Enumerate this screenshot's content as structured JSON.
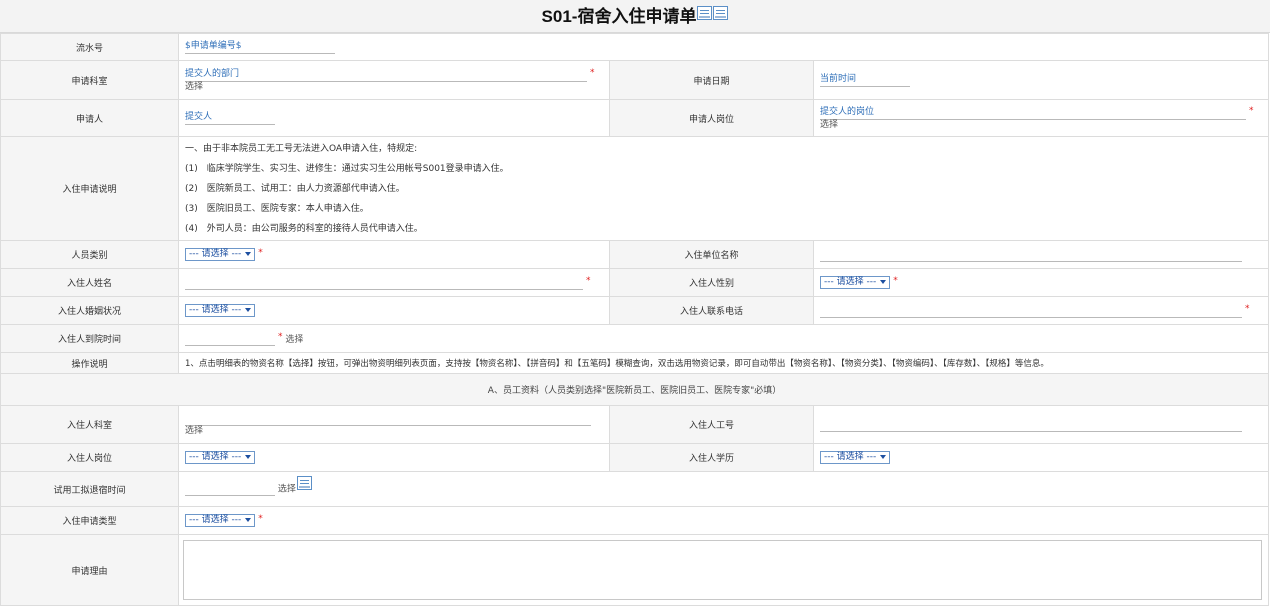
{
  "header": {
    "title": "S01-宿舍入住申请单"
  },
  "rows": {
    "serial": {
      "label": "流水号",
      "value": "$申请单编号$"
    },
    "dept": {
      "label": "申请科室",
      "value": "提交人的部门",
      "sub": "选择"
    },
    "apply_date": {
      "label": "申请日期",
      "value": "当前时间"
    },
    "applicant": {
      "label": "申请人",
      "value": "提交人"
    },
    "applicant_post": {
      "label": "申请人岗位",
      "value": "提交人的岗位",
      "sub": "选择"
    },
    "notes": {
      "label": "入住申请说明",
      "lines": [
        "一、由于非本院员工无工号无法进入OA申请入住，特规定:",
        "(1)　临床学院学生、实习生、进修生：通过实习生公用帐号S001登录申请入住。",
        "(2)　医院新员工、试用工：由人力资源部代申请入住。",
        "(3)　医院旧员工、医院专家：本人申请入住。",
        "(4)　外司人员：由公司服务的科室的接待人员代申请入住。"
      ]
    },
    "person_type": {
      "label": "人员类别",
      "select": "--- 请选择 ---"
    },
    "unit_name": {
      "label": "入住单位名称"
    },
    "occupant_name": {
      "label": "入住人姓名"
    },
    "gender": {
      "label": "入住人性别",
      "select": "--- 请选择 ---"
    },
    "marital": {
      "label": "入住人婚姻状况",
      "select": "--- 请选择 ---"
    },
    "phone": {
      "label": "入住人联系电话"
    },
    "arrival": {
      "label": "入住人到院时间",
      "sub": "选择"
    },
    "op_note": {
      "label": "操作说明",
      "text": "1、点击明细表的物资名称【选择】按钮，可弹出物资明细列表页面，支持按【物资名称】、【拼音码】和【五笔码】模糊查询，双击选用物资记录，即可自动带出【物资名称】、【物资分类】、【物资编码】、【库存数】、【规格】等信息。"
    },
    "section_a": "A、员工资料（人员类别选择\"医院新员工、医院旧员工、医院专家\"必填）",
    "occ_dept": {
      "label": "入住人科室",
      "sub": "选择"
    },
    "emp_no": {
      "label": "入住人工号"
    },
    "occ_post": {
      "label": "入住人岗位",
      "select": "--- 请选择 ---"
    },
    "education": {
      "label": "入住人学历",
      "select": "--- 请选择 ---"
    },
    "probation": {
      "label": "试用工拟退宿时间",
      "sub": "选择"
    },
    "apply_type": {
      "label": "入住申请类型",
      "select": "--- 请选择 ---"
    },
    "reason": {
      "label": "申请理由"
    }
  },
  "icons": {
    "title_icon_1": "document-icon",
    "title_icon_2": "document-icon",
    "calendar": "calendar-icon"
  },
  "colors": {
    "label_bg": "#f5f5f5",
    "border": "#dcdcdc",
    "link_blue": "#2f6fb8",
    "required_red": "#e02020"
  }
}
